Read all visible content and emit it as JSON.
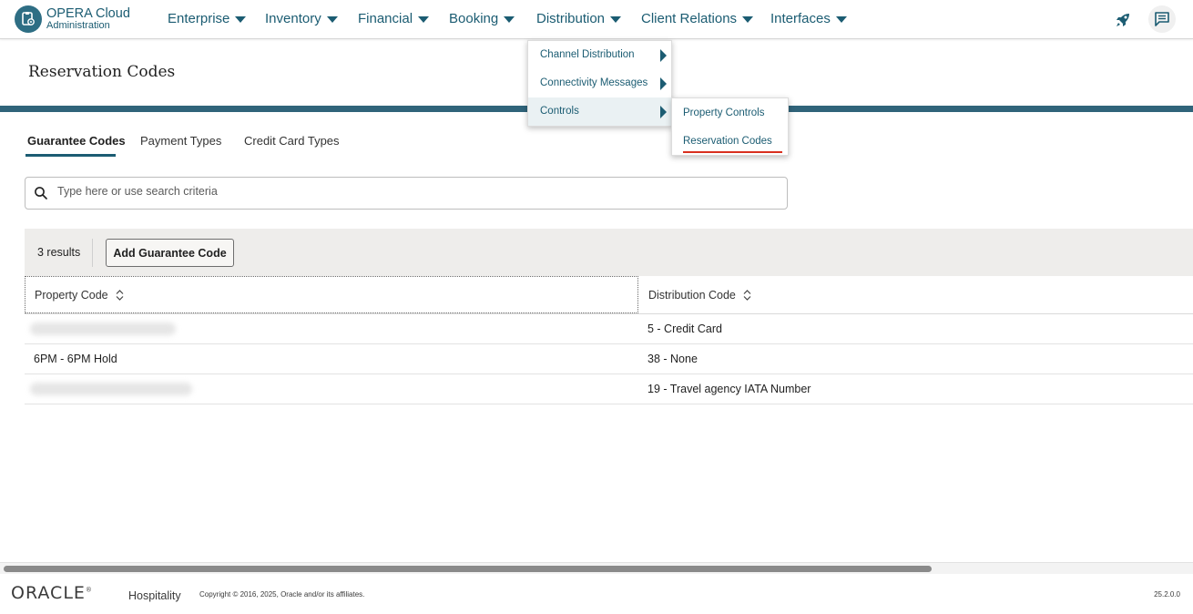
{
  "brand": {
    "title": "OPERA Cloud",
    "subtitle": "Administration",
    "icon": "opera-logo-icon"
  },
  "nav": {
    "items": [
      {
        "label": "Enterprise"
      },
      {
        "label": "Inventory"
      },
      {
        "label": "Financial"
      },
      {
        "label": "Booking"
      },
      {
        "label": "Distribution"
      },
      {
        "label": "Client Relations"
      },
      {
        "label": "Interfaces"
      }
    ],
    "icons": [
      "rocket-icon",
      "chat-icon"
    ]
  },
  "page": {
    "title": "Reservation Codes"
  },
  "tabs": [
    {
      "label": "Guarantee Codes",
      "active": true
    },
    {
      "label": "Payment Types",
      "active": false
    },
    {
      "label": "Credit Card Types",
      "active": false
    }
  ],
  "search": {
    "placeholder": "Type here or use search criteria",
    "value": ""
  },
  "toolbar": {
    "results": "3 results",
    "add_label": "Add Guarantee Code"
  },
  "table": {
    "columns": [
      "Property Code",
      "Distribution Code"
    ],
    "rows": [
      {
        "property_code": "",
        "distribution_code": "5 - Credit Card"
      },
      {
        "property_code": "6PM - 6PM Hold",
        "distribution_code": "38 - None"
      },
      {
        "property_code": "",
        "distribution_code": "19 - Travel agency IATA Number"
      }
    ]
  },
  "menu": {
    "items": [
      {
        "label": "Channel Distribution"
      },
      {
        "label": "Connectivity Messages"
      },
      {
        "label": "Controls"
      }
    ],
    "submenu": [
      {
        "label": "Property Controls"
      },
      {
        "label": "Reservation Codes"
      }
    ]
  },
  "footer": {
    "logo": "ORACLE",
    "product": "Hospitality",
    "copyright": "Copyright © 2016, 2025, Oracle and/or its affiliates.",
    "version": "25.2.0.0"
  },
  "colors": {
    "accent": "#1b5c72",
    "band": "#30647a",
    "highlight": "#d9301f"
  }
}
